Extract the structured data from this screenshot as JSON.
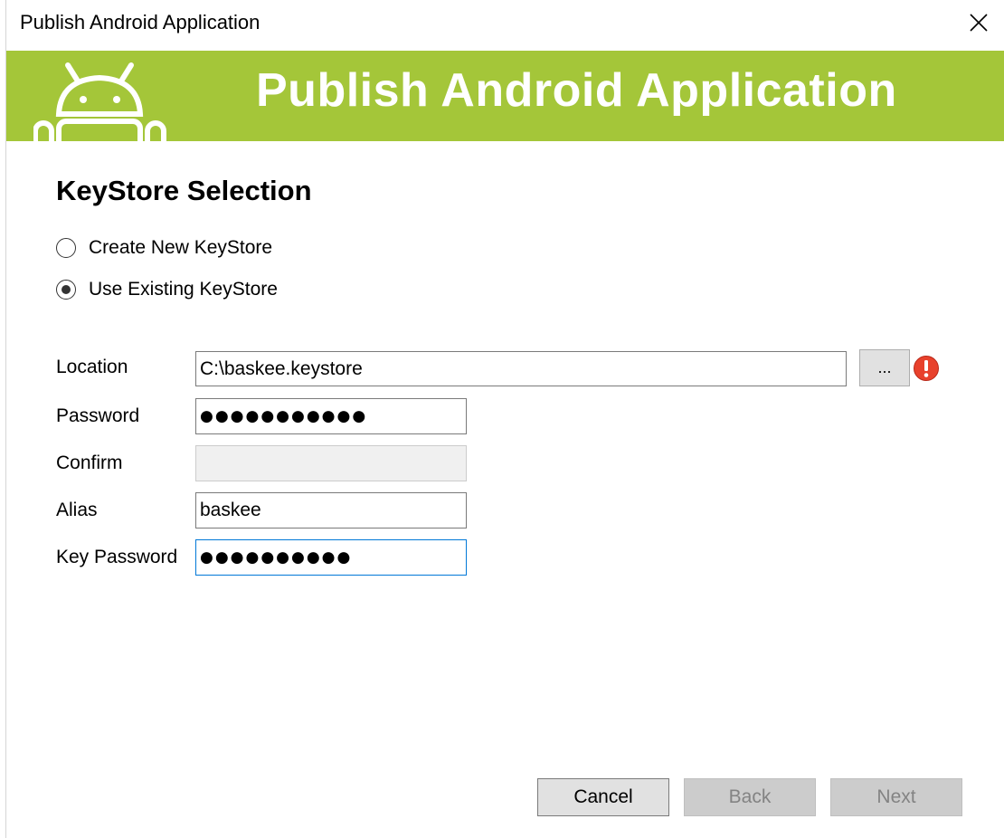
{
  "window": {
    "title": "Publish Android Application"
  },
  "banner": {
    "title": "Publish Android Application",
    "background_color": "#a4c639"
  },
  "section": {
    "heading": "KeyStore Selection"
  },
  "keystore_options": [
    {
      "label": "Create New KeyStore",
      "selected": false
    },
    {
      "label": "Use Existing KeyStore",
      "selected": true
    }
  ],
  "form": {
    "location": {
      "label": "Location",
      "value": "C:\\baskee.keystore"
    },
    "browse_label": "...",
    "password": {
      "label": "Password",
      "value": "●●●●●●●●●●●"
    },
    "confirm": {
      "label": "Confirm",
      "value": ""
    },
    "alias": {
      "label": "Alias",
      "value": "baskee"
    },
    "key_password": {
      "label": "Key Password",
      "value": "●●●●●●●●●●"
    }
  },
  "buttons": {
    "cancel": "Cancel",
    "back": "Back",
    "next": "Next"
  },
  "icons": {
    "close": "close-icon",
    "android": "android-logo-icon",
    "error": "error-icon"
  },
  "colors": {
    "banner": "#a4c639",
    "error": "#e8412c",
    "focus_border": "#0078d7"
  }
}
